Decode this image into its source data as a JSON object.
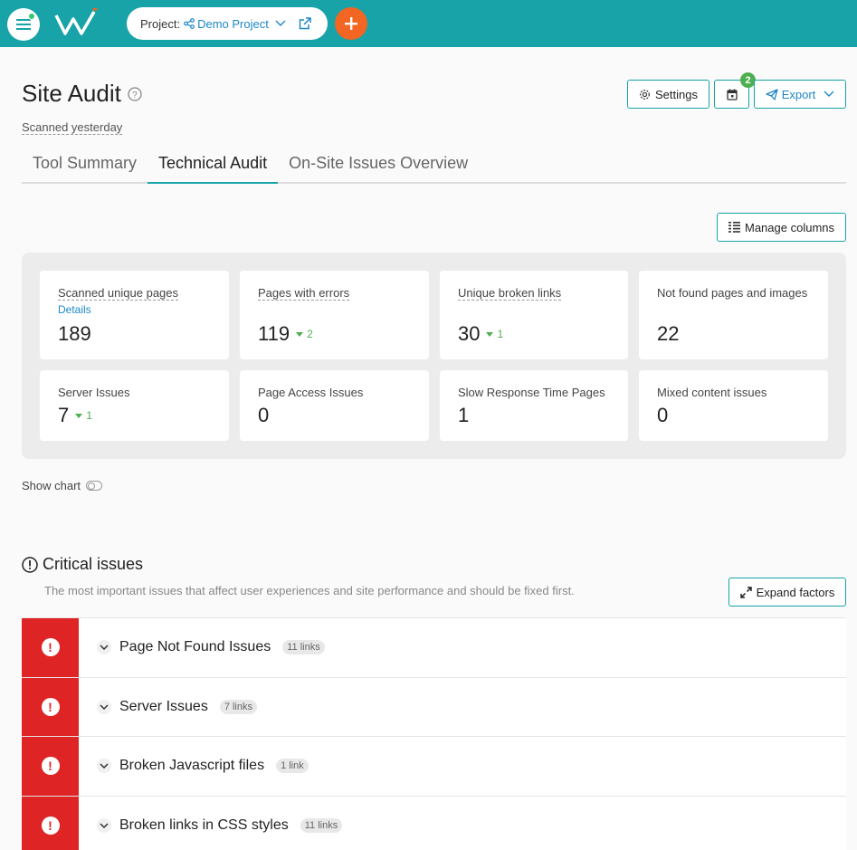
{
  "colors": {
    "brand": "#17a3a7",
    "accent": "#f26522",
    "link": "#1e88c7",
    "critical": "#de2424",
    "positive": "#4caf50"
  },
  "topbar": {
    "menu_icon": "hamburger-icon",
    "logo_icon": "brand-logo",
    "project_label": "Project:",
    "project_name": "Demo Project",
    "add_icon": "plus-icon"
  },
  "header": {
    "title": "Site Audit",
    "scanned": "Scanned yesterday",
    "settings_label": "Settings",
    "schedule_badge": "2",
    "export_label": "Export"
  },
  "tabs": [
    {
      "label": "Tool Summary",
      "active": false
    },
    {
      "label": "Technical Audit",
      "active": true
    },
    {
      "label": "On-Site Issues Overview",
      "active": false
    }
  ],
  "manage_columns_label": "Manage columns",
  "stats": [
    {
      "label": "Scanned unique pages",
      "details": "Details",
      "value": "189",
      "delta": ""
    },
    {
      "label": "Pages with errors",
      "value": "119",
      "delta": "2"
    },
    {
      "label": "Unique broken links",
      "value": "30",
      "delta": "1"
    },
    {
      "label": "Not found pages and images",
      "value": "22",
      "delta": ""
    },
    {
      "label": "Server Issues",
      "value": "7",
      "delta": "1"
    },
    {
      "label": "Page Access Issues",
      "value": "0",
      "delta": ""
    },
    {
      "label": "Slow Response Time Pages",
      "value": "1",
      "delta": ""
    },
    {
      "label": "Mixed content issues",
      "value": "0",
      "delta": ""
    }
  ],
  "show_chart_label": "Show chart",
  "critical": {
    "title": "Critical issues",
    "description": "The most important issues that affect user experiences and site performance and should be fixed first.",
    "expand_label": "Expand factors",
    "issues": [
      {
        "name": "Page Not Found Issues",
        "count": "11 links"
      },
      {
        "name": "Server Issues",
        "count": "7 links"
      },
      {
        "name": "Broken Javascript files",
        "count": "1 link"
      },
      {
        "name": "Broken links in CSS styles",
        "count": "11 links"
      }
    ]
  }
}
